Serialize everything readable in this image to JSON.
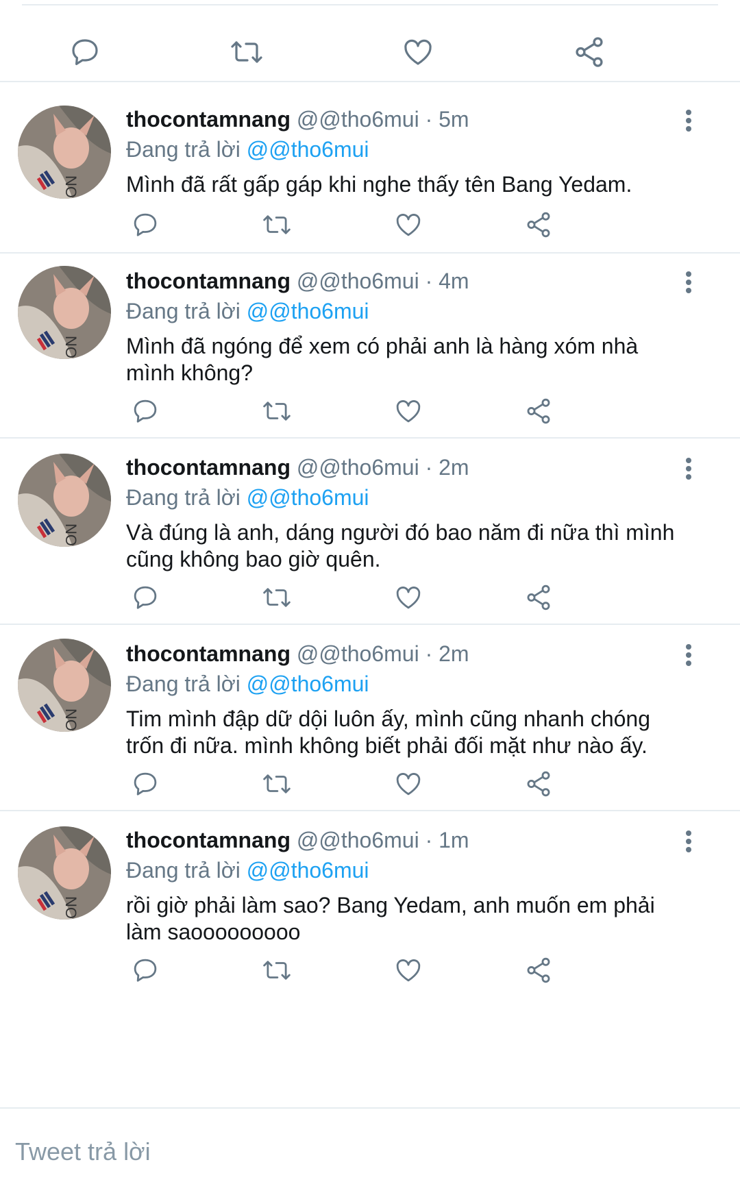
{
  "top_actions": {
    "icons": [
      "reply-icon",
      "retweet-icon",
      "like-icon",
      "share-icon"
    ]
  },
  "replies": [
    {
      "name": "thocontamnang",
      "handle": "@@tho6mui",
      "separator": "·",
      "time": "5m",
      "replying_label": "Đang trả lời",
      "replying_to": "@@tho6mui",
      "text": "Mình đã rất gấp gáp khi nghe thấy tên Bang Yedam."
    },
    {
      "name": "thocontamnang",
      "handle": "@@tho6mui",
      "separator": "·",
      "time": "4m",
      "replying_label": "Đang trả lời",
      "replying_to": "@@tho6mui",
      "text": "Mình đã ngóng để xem có phải anh là hàng xóm nhà mình không?"
    },
    {
      "name": "thocontamnang",
      "handle": "@@tho6mui",
      "separator": "·",
      "time": "2m",
      "replying_label": "Đang trả lời",
      "replying_to": "@@tho6mui",
      "text": "Và đúng là anh, dáng người đó bao năm đi nữa thì mình cũng không bao giờ quên."
    },
    {
      "name": "thocontamnang",
      "handle": "@@tho6mui",
      "separator": "·",
      "time": "2m",
      "replying_label": "Đang trả lời",
      "replying_to": "@@tho6mui",
      "text": "Tim mình đập dữ dội luôn ấy, mình cũng nhanh chóng trốn đi nữa. mình không biết phải đối mặt như nào ấy."
    },
    {
      "name": "thocontamnang",
      "handle": "@@tho6mui",
      "separator": "·",
      "time": "1m",
      "replying_label": "Đang trả lời",
      "replying_to": "@@tho6mui",
      "text": "rồi giờ phải làm sao? Bang Yedam, anh muốn em phải làm saooooooooo"
    }
  ],
  "compose": {
    "placeholder": "Tweet trả lời"
  },
  "colors": {
    "icon": "#657786",
    "mention": "#1da1f2",
    "divider": "#e6ecf0"
  }
}
